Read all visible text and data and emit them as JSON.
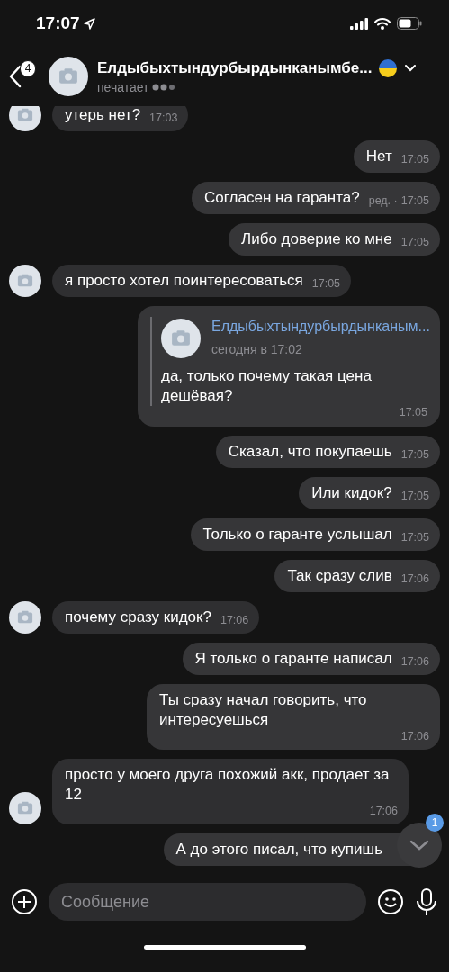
{
  "status_bar": {
    "time": "17:07"
  },
  "header": {
    "back_badge": "4",
    "name": "Елдыбыхтындурбырдынканымбе...",
    "status": "печатает"
  },
  "messages": [
    {
      "kind": "incoming",
      "text": "утерь нет?",
      "time": "17:03"
    },
    {
      "kind": "outgoing",
      "text": "Нет",
      "time": "17:05"
    },
    {
      "kind": "outgoing",
      "text": "Согласен на гаранта?",
      "edited": "ред. ·",
      "time": "17:05"
    },
    {
      "kind": "outgoing",
      "text": "Либо доверие ко мне",
      "time": "17:05"
    },
    {
      "kind": "incoming",
      "text": "я просто хотел поинтересоваться",
      "time": "17:05"
    },
    {
      "kind": "outgoing",
      "reply": {
        "name": "Елдыбыхтындурбырдынканым...",
        "date": "сегодня в 17:02"
      },
      "text": "да, только почему такая цена дешёвая?",
      "time": "17:05"
    },
    {
      "kind": "outgoing",
      "text": "Сказал, что покупаешь",
      "time": "17:05"
    },
    {
      "kind": "outgoing",
      "text": "Или кидок?",
      "time": "17:05"
    },
    {
      "kind": "outgoing",
      "text": "Только о гаранте услышал",
      "time": "17:05"
    },
    {
      "kind": "outgoing",
      "text": "Так сразу слив",
      "time": "17:06"
    },
    {
      "kind": "incoming",
      "text": "почему сразу кидок?",
      "time": "17:06"
    },
    {
      "kind": "outgoing",
      "text": "Я только о гаранте написал",
      "time": "17:06"
    },
    {
      "kind": "outgoing",
      "text": "Ты сразу начал говорить, что интересуешься",
      "time": "17:06"
    },
    {
      "kind": "incoming",
      "text": "просто у моего друга похожий акк, продает за 12",
      "time": "17:06"
    },
    {
      "kind": "outgoing",
      "text": "А до этого писал, что купишь"
    }
  ],
  "scroll_button": {
    "badge": "1"
  },
  "composer": {
    "placeholder": "Сообщение"
  }
}
